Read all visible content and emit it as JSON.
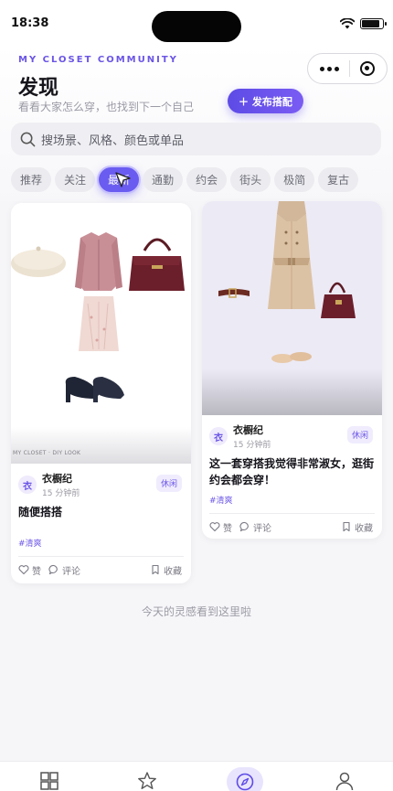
{
  "status_bar": {
    "time": "18:38"
  },
  "header": {
    "eyebrow": "MY CLOSET COMMUNITY",
    "title": "发现",
    "subtitle": "看看大家怎么穿，也找到下一个自己",
    "publish_label": "＋ 发布搭配"
  },
  "search": {
    "placeholder": "搜场景、风格、颜色或单品"
  },
  "tabs": [
    {
      "label": "推荐",
      "active": false
    },
    {
      "label": "关注",
      "active": false
    },
    {
      "label": "最新",
      "active": true
    },
    {
      "label": "通勤",
      "active": false
    },
    {
      "label": "约会",
      "active": false
    },
    {
      "label": "街头",
      "active": false
    },
    {
      "label": "极简",
      "active": false
    },
    {
      "label": "复古",
      "active": false
    }
  ],
  "posts": [
    {
      "avatar": "衣",
      "author": "衣橱纪",
      "time": "15 分钟前",
      "tag": "休闲",
      "title": "随便搭搭",
      "hashtag": "#清爽",
      "watermark": "MY CLOSET · DIY LOOK",
      "like_label": "赞",
      "comment_label": "评论",
      "save_label": "收藏"
    },
    {
      "avatar": "衣",
      "author": "衣橱纪",
      "time": "15 分钟前",
      "tag": "休闲",
      "title": "这一套穿搭我觉得非常淑女，逛街约会都会穿！",
      "hashtag": "#清爽",
      "like_label": "赞",
      "comment_label": "评论",
      "save_label": "收藏"
    }
  ],
  "feed_end": "今天的灵感看到这里啦",
  "colors": {
    "accent": "#6a55e6",
    "accent_light": "#f0ecfe",
    "background": "#f6f6f9"
  }
}
